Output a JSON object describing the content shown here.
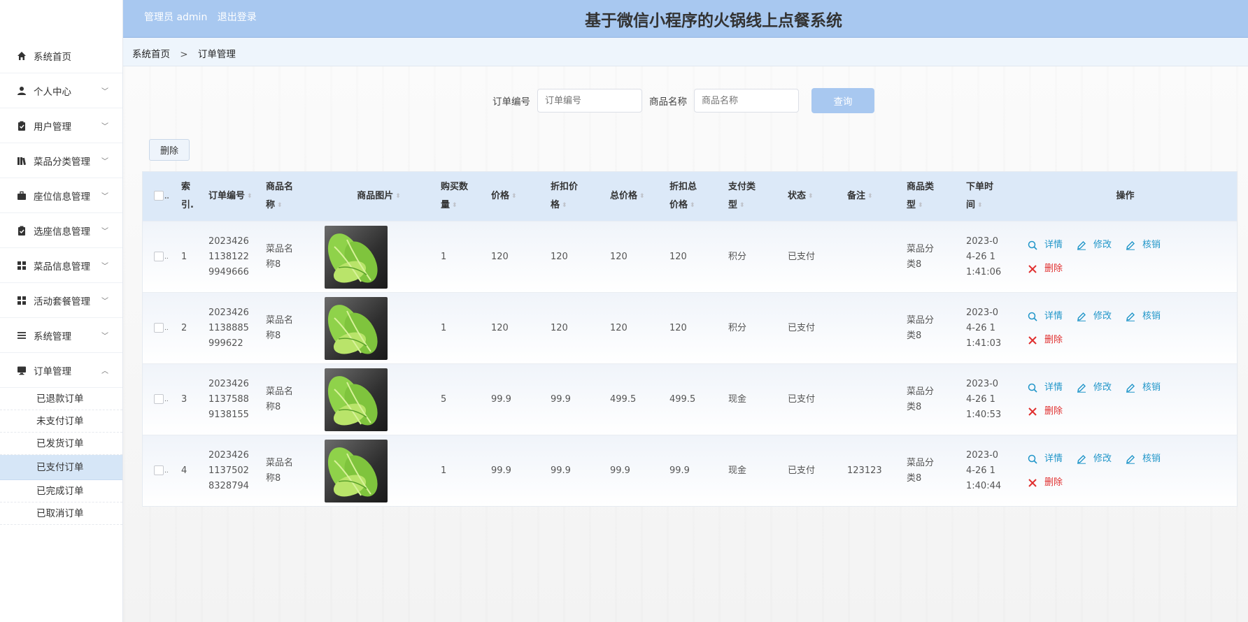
{
  "header": {
    "user_label": "管理员 admin",
    "logout": "退出登录",
    "title": "基于微信小程序的火锅线上点餐系统"
  },
  "sidebar": {
    "items": [
      {
        "label": "系统首页",
        "icon": "home-icon"
      },
      {
        "label": "个人中心",
        "icon": "user-icon"
      },
      {
        "label": "用户管理",
        "icon": "clipboard-icon"
      },
      {
        "label": "菜品分类管理",
        "icon": "books-icon"
      },
      {
        "label": "座位信息管理",
        "icon": "briefcase-icon"
      },
      {
        "label": "选座信息管理",
        "icon": "clipboard-icon"
      },
      {
        "label": "菜品信息管理",
        "icon": "grid-icon"
      },
      {
        "label": "活动套餐管理",
        "icon": "grid-icon"
      },
      {
        "label": "系统管理",
        "icon": "list-icon"
      },
      {
        "label": "订单管理",
        "icon": "monitor-icon"
      }
    ],
    "sub_items": [
      "已退款订单",
      "未支付订单",
      "已发货订单",
      "已支付订单",
      "已完成订单",
      "已取消订单"
    ],
    "active_sub": "已支付订单"
  },
  "breadcrumb": {
    "home": "系统首页",
    "sep": ">",
    "current": "订单管理"
  },
  "search": {
    "order_label": "订单编号",
    "order_placeholder": "订单编号",
    "goods_label": "商品名称",
    "goods_placeholder": "商品名称",
    "query": "查询"
  },
  "toolbar": {
    "delete": "删除"
  },
  "table": {
    "headers": {
      "index": [
        "索",
        "引."
      ],
      "order_no": [
        "订单编号"
      ],
      "goods_name": [
        "商品名",
        "称"
      ],
      "goods_img": [
        "商品图片"
      ],
      "qty": [
        "购买数",
        "量"
      ],
      "price": [
        "价格"
      ],
      "discount_price": [
        "折扣价",
        "格"
      ],
      "total": [
        "总价格"
      ],
      "discount_total": [
        "折扣总",
        "价格"
      ],
      "pay_type": [
        "支付类",
        "型"
      ],
      "status": [
        "状态"
      ],
      "remark": [
        "备注"
      ],
      "goods_type": [
        "商品类",
        "型"
      ],
      "order_time": [
        "下单时",
        "间"
      ],
      "ops": [
        "操作"
      ]
    },
    "rows": [
      {
        "index": "1",
        "order_no": [
          "2023426",
          "1138122",
          "9949666"
        ],
        "goods_name": [
          "菜品名",
          "称8"
        ],
        "qty": "1",
        "price": "120",
        "discount_price": "120",
        "total": "120",
        "discount_total": "120",
        "pay_type": "积分",
        "status": "已支付",
        "remark": "",
        "goods_type": [
          "菜品分",
          "类8"
        ],
        "order_time": [
          "2023-0",
          "4-26 1",
          "1:41:06"
        ]
      },
      {
        "index": "2",
        "order_no": [
          "2023426",
          "1138885",
          "999622"
        ],
        "goods_name": [
          "菜品名",
          "称8"
        ],
        "qty": "1",
        "price": "120",
        "discount_price": "120",
        "total": "120",
        "discount_total": "120",
        "pay_type": "积分",
        "status": "已支付",
        "remark": "",
        "goods_type": [
          "菜品分",
          "类8"
        ],
        "order_time": [
          "2023-0",
          "4-26 1",
          "1:41:03"
        ]
      },
      {
        "index": "3",
        "order_no": [
          "2023426",
          "1137588",
          "9138155"
        ],
        "goods_name": [
          "菜品名",
          "称8"
        ],
        "qty": "5",
        "price": "99.9",
        "discount_price": "99.9",
        "total": "499.5",
        "discount_total": "499.5",
        "pay_type": "现金",
        "status": "已支付",
        "remark": "",
        "goods_type": [
          "菜品分",
          "类8"
        ],
        "order_time": [
          "2023-0",
          "4-26 1",
          "1:40:53"
        ]
      },
      {
        "index": "4",
        "order_no": [
          "2023426",
          "1137502",
          "8328794"
        ],
        "goods_name": [
          "菜品名",
          "称8"
        ],
        "qty": "1",
        "price": "99.9",
        "discount_price": "99.9",
        "total": "99.9",
        "discount_total": "99.9",
        "pay_type": "现金",
        "status": "已支付",
        "remark": "123123",
        "goods_type": [
          "菜品分",
          "类8"
        ],
        "order_time": [
          "2023-0",
          "4-26 1",
          "1:40:44"
        ]
      }
    ],
    "actions": {
      "detail": "详情",
      "edit": "修改",
      "verify": "核销",
      "delete": "删除"
    }
  },
  "colors": {
    "accent": "#a8c8f0",
    "link": "#2196c9",
    "danger": "#e02f2f"
  }
}
